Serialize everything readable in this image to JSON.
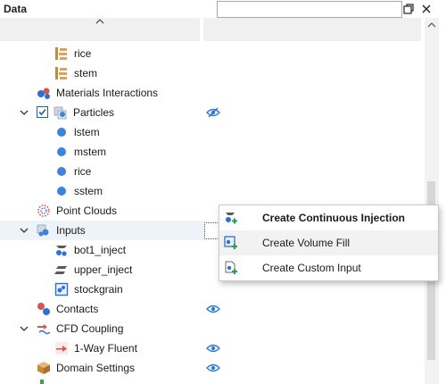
{
  "panel": {
    "title": "Data",
    "search": {
      "value": "",
      "placeholder": ""
    }
  },
  "tree": {
    "rows": [
      {
        "label": "rice",
        "icon": "material-brick-icon"
      },
      {
        "label": "stem",
        "icon": "material-brick-icon"
      },
      {
        "label": "Materials Interactions",
        "icon": "materials-interactions-icon"
      },
      {
        "label": "Particles",
        "icon": "particles-icon",
        "checked": true,
        "visibility": "hidden"
      },
      {
        "label": "lstem",
        "icon": "particle-dot-icon"
      },
      {
        "label": "mstem",
        "icon": "particle-dot-icon"
      },
      {
        "label": "rice",
        "icon": "particle-dot-icon"
      },
      {
        "label": "sstem",
        "icon": "particle-dot-icon"
      },
      {
        "label": "Point Clouds",
        "icon": "point-clouds-icon"
      },
      {
        "label": "Inputs",
        "icon": "inputs-icon"
      },
      {
        "label": "bot1_inject",
        "icon": "continuous-injection-icon"
      },
      {
        "label": "upper_inject",
        "icon": "injection-icon"
      },
      {
        "label": "stockgrain",
        "icon": "volume-fill-icon"
      },
      {
        "label": "Contacts",
        "icon": "contacts-icon",
        "visibility": "visible"
      },
      {
        "label": "CFD Coupling",
        "icon": "cfd-coupling-icon"
      },
      {
        "label": "1-Way Fluent",
        "icon": "fluent-icon",
        "visibility": "visible"
      },
      {
        "label": "Domain Settings",
        "icon": "domain-settings-icon",
        "visibility": "visible"
      }
    ]
  },
  "context_menu": {
    "items": [
      {
        "label": "Create Continuous Injection",
        "icon": "continuous-injection-add-icon",
        "bold": true
      },
      {
        "label": "Create Volume Fill",
        "icon": "volume-fill-add-icon"
      },
      {
        "label": "Create Custom Input",
        "icon": "custom-input-add-icon"
      }
    ]
  },
  "colors": {
    "accent_blue": "#3d82dc",
    "highlight": "#eef3fa",
    "menu_hover": "#f2f2f2"
  }
}
